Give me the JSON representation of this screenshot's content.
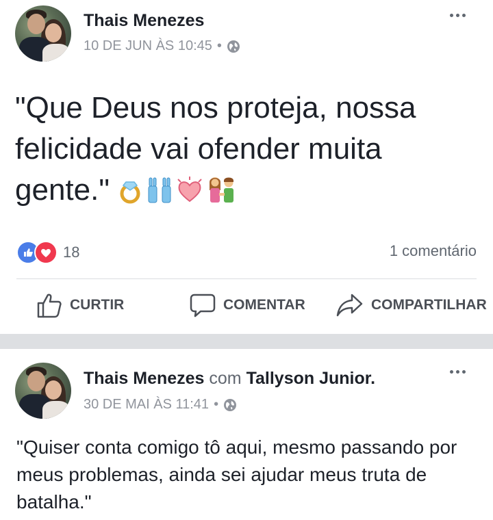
{
  "posts": [
    {
      "author": "Thais Menezes",
      "timestamp": "10 DE JUN ÀS 10:45",
      "separator": "•",
      "privacy_icon": "globe-icon",
      "text": "\"Que Deus nos proteja, nossa felicidade vai ofender muita gente.\"",
      "emojis": [
        "ring",
        "people-with-bunny-ears",
        "sparkling-heart",
        "couple"
      ],
      "reactions": {
        "icons": [
          "like",
          "love"
        ],
        "count": "18"
      },
      "comments_label": "1 comentário",
      "actions": {
        "like": "CURTIR",
        "comment": "COMENTAR",
        "share": "COMPARTILHAR"
      }
    },
    {
      "author": "Thais Menezes",
      "with_word": "com",
      "tagged": "Tallyson Junior",
      "tagged_suffix": ".",
      "timestamp": "30 DE MAI ÀS 11:41",
      "separator": "•",
      "privacy_icon": "globe-icon",
      "text": "\"Quiser conta comigo tô aqui, mesmo passando por meus problemas, ainda sei ajudar meus truta de batalha.\""
    }
  ],
  "colors": {
    "like_blue": "#4a7de8",
    "love_red": "#f0384e",
    "separator_gray": "#dddfe2"
  }
}
